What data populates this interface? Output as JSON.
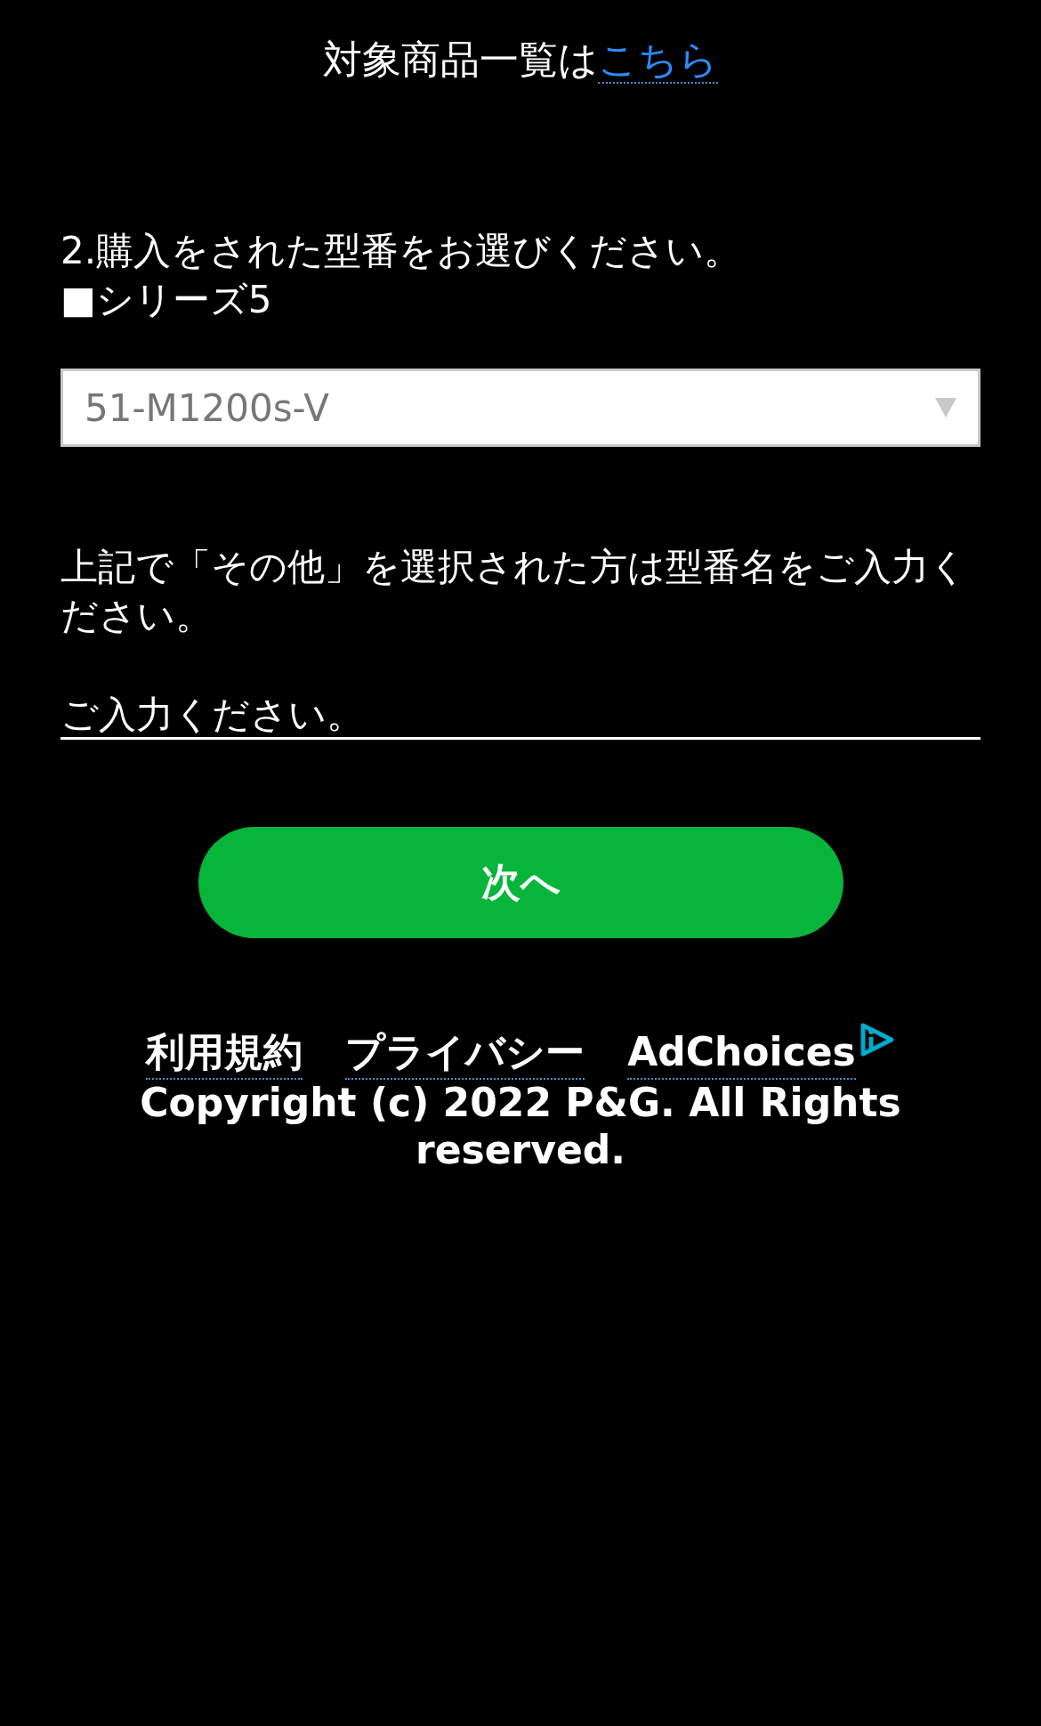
{
  "header": {
    "text": "対象商品一覧は",
    "link": "こちら"
  },
  "question": {
    "title": "2.購入をされた型番をお選びください。",
    "subtitle": "■シリーズ5"
  },
  "model_select": {
    "value": "51-M1200s-V"
  },
  "other_note": "上記で「その他」を選択された方は型番名をご入力ください。",
  "other_input": {
    "placeholder": "ご入力ください。"
  },
  "next_button": "次へ",
  "footer": {
    "links": [
      {
        "label": "利用規約",
        "kind": "text"
      },
      {
        "label": "プライバシー",
        "kind": "text"
      },
      {
        "label": "AdChoices",
        "kind": "adchoices"
      }
    ],
    "copyright": "Copyright (c) 2022 P&G. All Rights reserved."
  }
}
